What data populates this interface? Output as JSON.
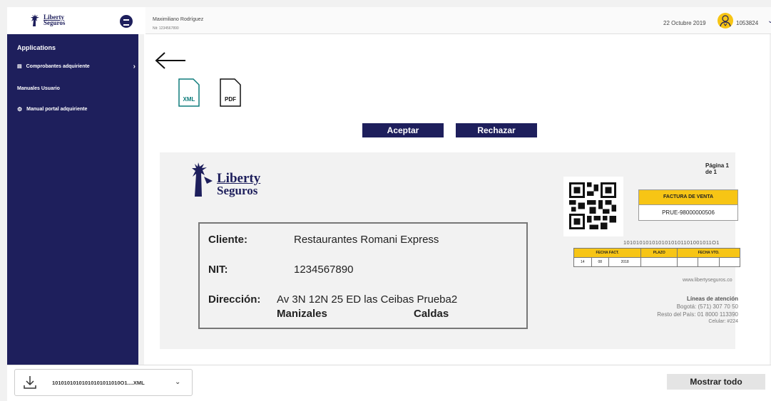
{
  "header": {
    "user_name": "Maximiliano Rodríguez",
    "user_nit": "Nit: 1234567890",
    "date": "22 Octubre 2019",
    "user_id": "1053824"
  },
  "sidebar": {
    "applications_heading": "Applications",
    "comprobantes_label": "Comprobantes adquiriente",
    "manuales_heading": "Manuales Usuario",
    "manual_portal_label": "Manual portal adquiriente"
  },
  "logo": {
    "line1": "Liberty",
    "line2": "Seguros"
  },
  "files": {
    "xml_label": "XML",
    "pdf_label": "PDF"
  },
  "actions": {
    "accept_label": "Aceptar",
    "reject_label": "Rechazar"
  },
  "document": {
    "page_label": "Página 1 de 1",
    "client": {
      "cliente_label": "Cliente:",
      "cliente_value": "Restaurantes Romani Express",
      "nit_label": "NIT:",
      "nit_value": "1234567890",
      "direccion_label": "Dirección:",
      "direccion_value": "Av 3N 12N 25 ED las Ceibas Prueba2",
      "city": "Manizales",
      "department": "Caldas"
    },
    "invoice_title": "FACTURA DE VENTA",
    "invoice_number": "PRUE-98000000506",
    "barcode_text": "1010101010101010101101001011O1",
    "date_table": {
      "headers": [
        "FECHA FACT.",
        "PLAZO",
        "FECHA VTO."
      ],
      "values": [
        "14",
        "08",
        "2018",
        "",
        "",
        "",
        ""
      ]
    },
    "website": "www.libertyseguros.co",
    "attention_title": "Líneas de atención",
    "attention_lines": [
      "Bogotá: (571) 307 70 50",
      "Resto del País: 01 8000 113390",
      "Celular: #224"
    ]
  },
  "downloads": {
    "file_name": "10101010101010101011010O1....XML",
    "show_all_label": "Mostrar todo"
  },
  "colors": {
    "brand_navy": "#1e1f5c",
    "accent_yellow": "#f7c515"
  }
}
